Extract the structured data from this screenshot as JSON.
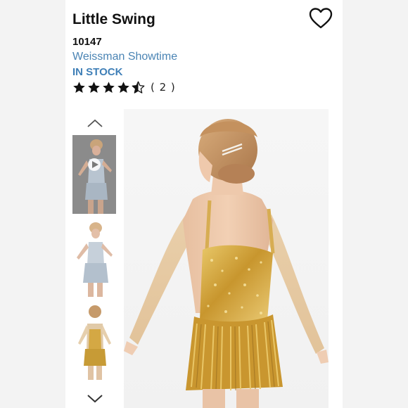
{
  "product": {
    "title": "Little Swing",
    "sku": "10147",
    "brand": "Weissman Showtime",
    "stock_status": "IN STOCK",
    "rating": 4.5,
    "rating_max": 5,
    "review_count": "( 2 )"
  },
  "gallery": {
    "up_icon": "chevron-up-icon",
    "down_icon": "chevron-down-icon",
    "thumbnails": [
      {
        "kind": "video",
        "icon": "play-icon"
      },
      {
        "kind": "image"
      },
      {
        "kind": "image"
      }
    ]
  },
  "colors": {
    "brand_link": "#4a84b4",
    "stock": "#3f7fb7",
    "costume_gold": "#d4a844",
    "costume_silver": "#b9c4cf"
  }
}
